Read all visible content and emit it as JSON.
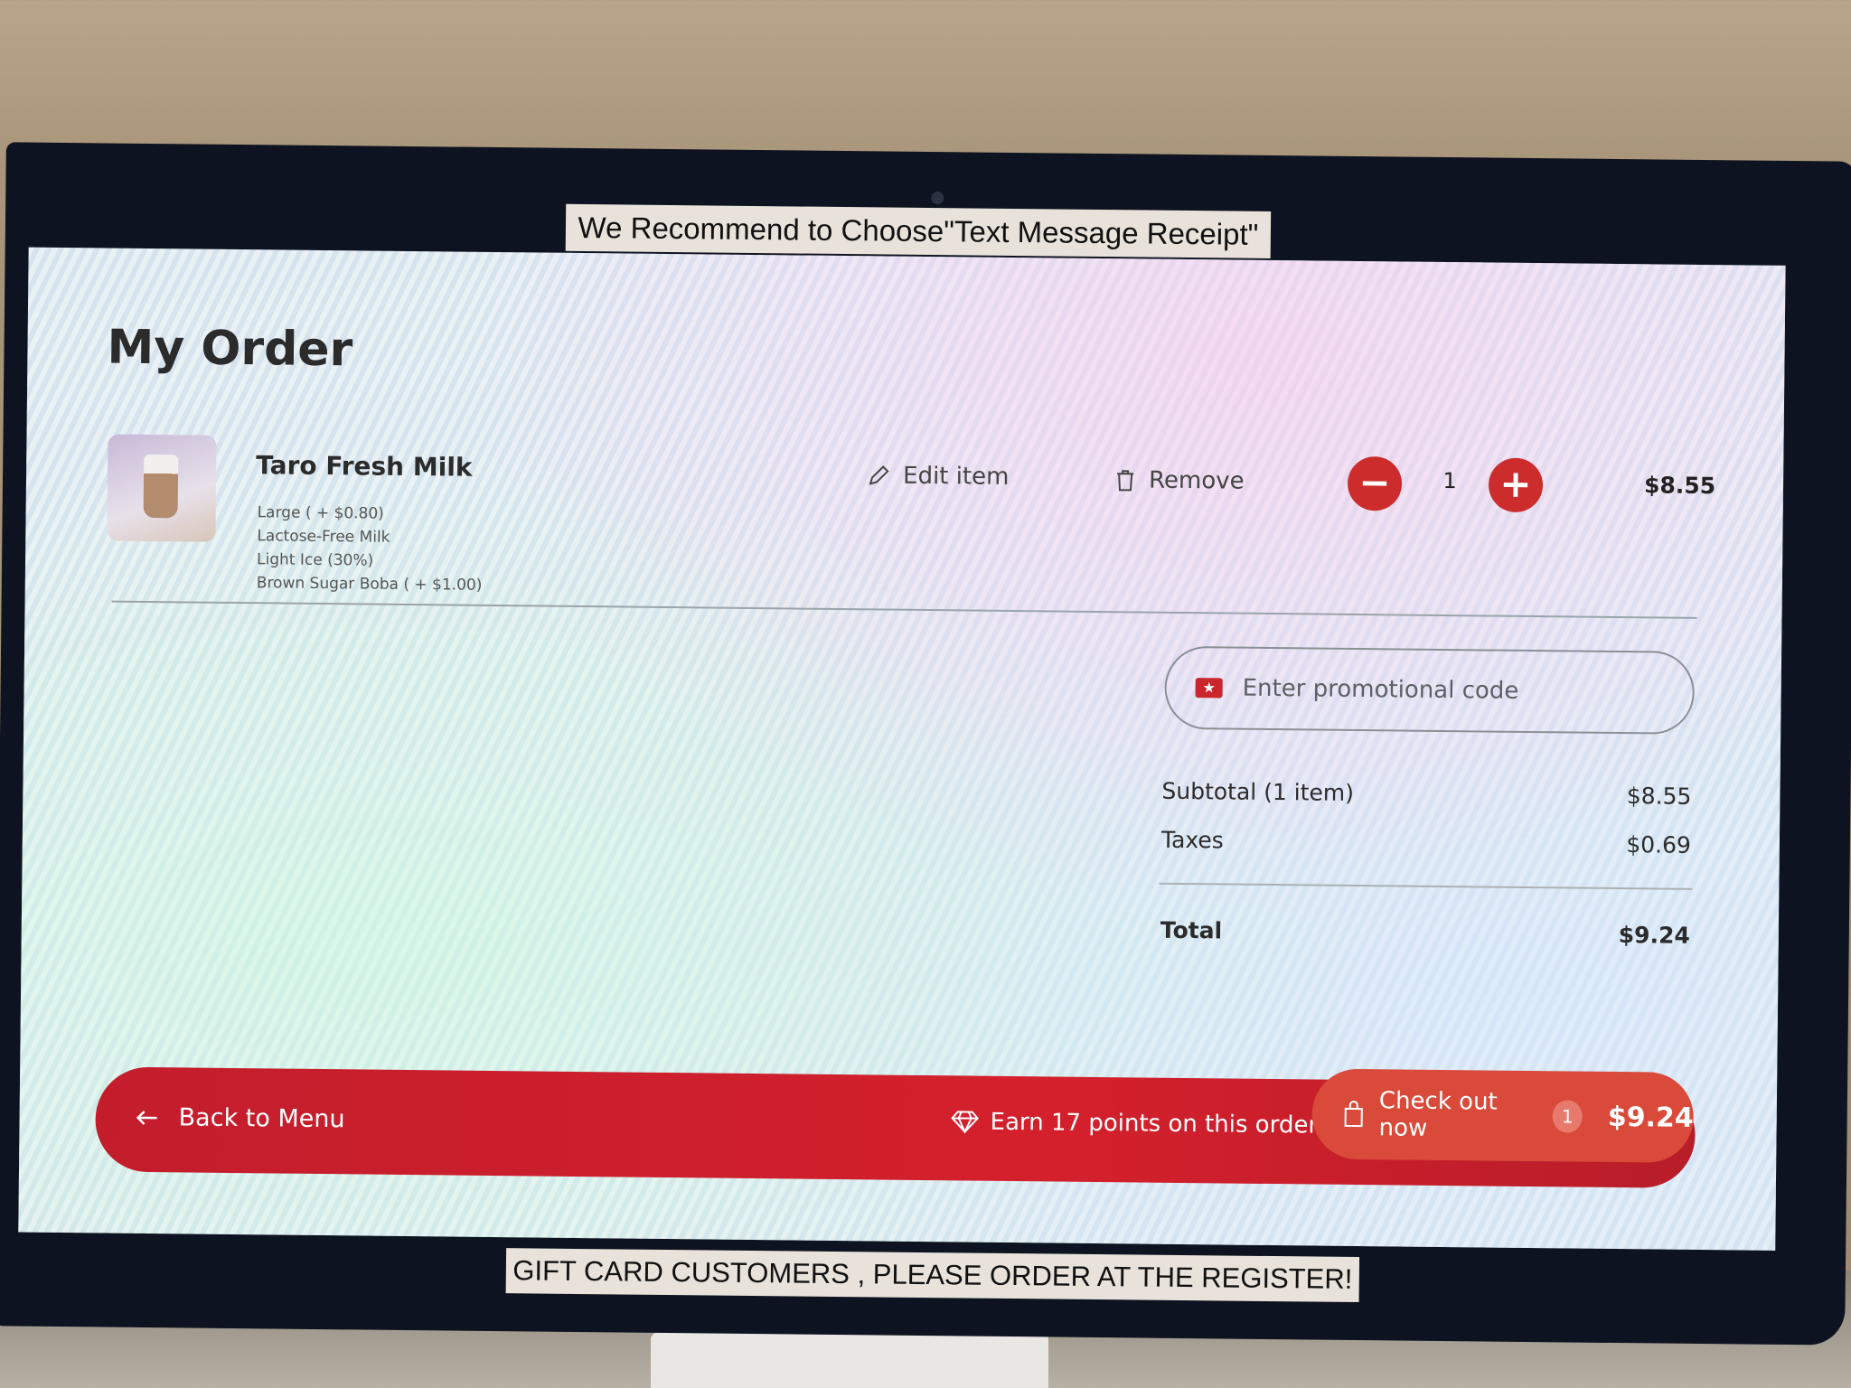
{
  "stickers": {
    "top": "We Recommend to Choose\"Text Message Receipt\"",
    "bottom": "GIFT CARD CUSTOMERS , PLEASE ORDER AT THE REGISTER!"
  },
  "page": {
    "title": "My Order"
  },
  "item": {
    "name": "Taro Fresh Milk",
    "modifiers": [
      "Large ( + $0.80)",
      "Lactose-Free Milk",
      "Light Ice (30%)",
      "Brown Sugar Boba ( + $1.00)"
    ],
    "edit_label": "Edit item",
    "remove_label": "Remove",
    "minus_label": "−",
    "plus_label": "+",
    "quantity": "1",
    "price": "$8.55"
  },
  "promo": {
    "placeholder": "Enter promotional code"
  },
  "summary": {
    "subtotal_label": "Subtotal (1 item)",
    "subtotal_value": "$8.55",
    "taxes_label": "Taxes",
    "taxes_value": "$0.69",
    "total_label": "Total",
    "total_value": "$9.24"
  },
  "footer": {
    "back_label": "Back to Menu",
    "earn_text": "Earn 17 points on this order!",
    "checkout_label": "Check out now",
    "checkout_count": "1",
    "checkout_total": "$9.24"
  },
  "colors": {
    "accent": "#cc2c2c",
    "bar": "#c31d2c"
  },
  "icons": {
    "edit": "pencil-icon",
    "remove": "trash-icon",
    "promo": "ticket-icon",
    "back": "arrow-left-icon",
    "earn": "diamond-icon",
    "checkout": "shopping-bag-icon"
  }
}
